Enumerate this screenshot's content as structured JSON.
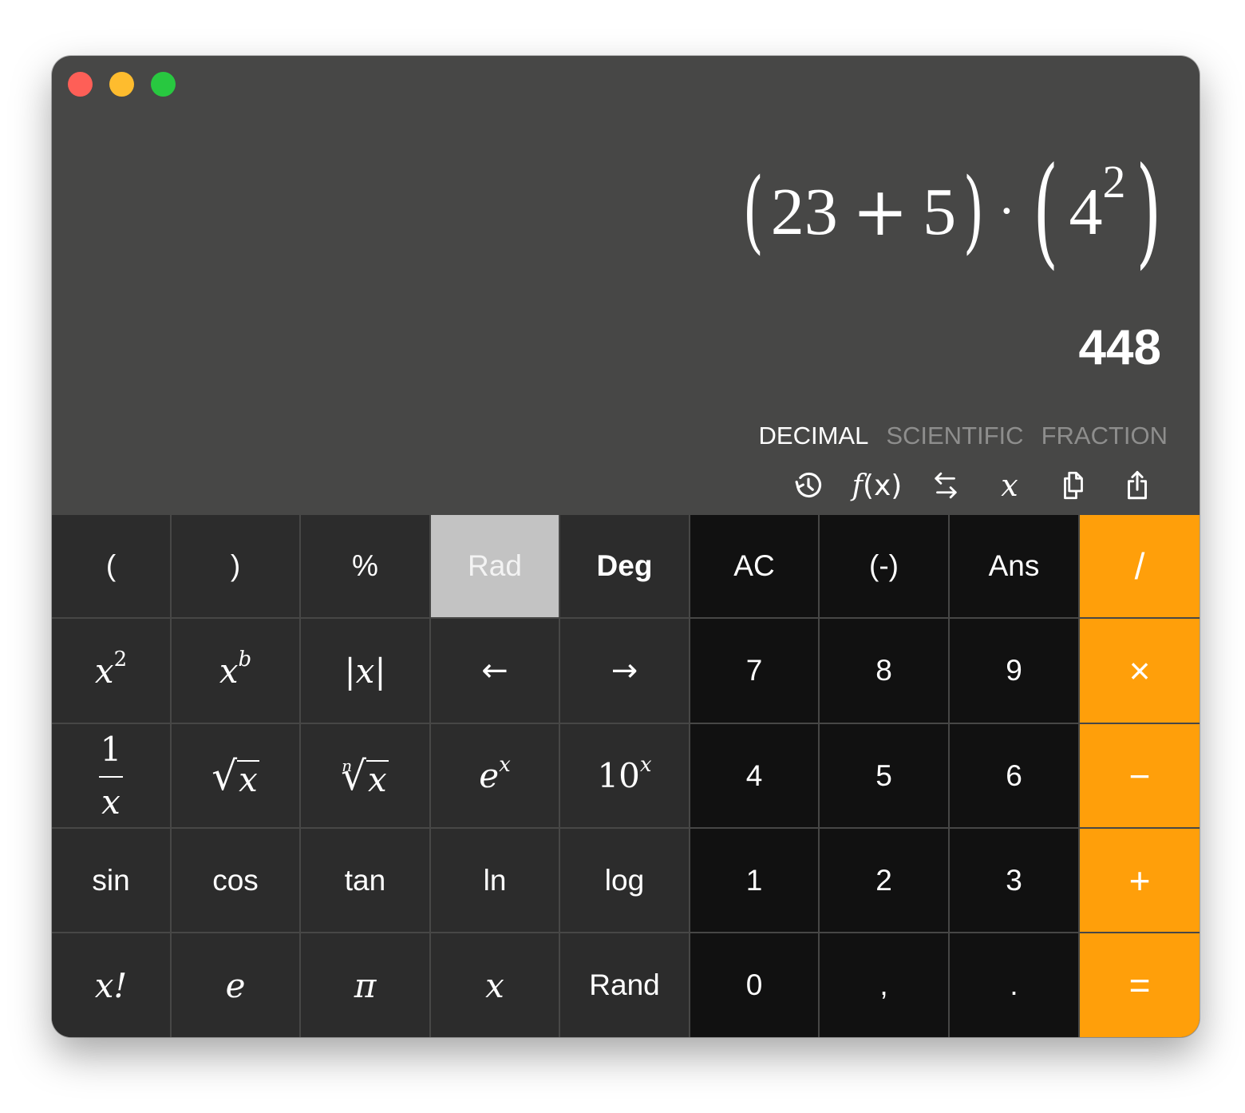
{
  "window": {
    "controls": [
      "close",
      "minimize",
      "zoom"
    ],
    "colors": {
      "close": "#fe5f57",
      "minimize": "#febc2e",
      "zoom": "#28c840",
      "background": "#474746",
      "accent": "#ff9f0a"
    }
  },
  "display": {
    "expression": {
      "open1": "(",
      "a": "23",
      "plus": "+",
      "b": "5",
      "close1": ")",
      "dot": "·",
      "open2": "(",
      "base": "4",
      "exponent": "2",
      "close2": ")"
    },
    "result": "448",
    "modes": [
      {
        "label": "DECIMAL",
        "active": true
      },
      {
        "label": "SCIENTIFIC",
        "active": false
      },
      {
        "label": "FRACTION",
        "active": false
      }
    ],
    "tools": [
      {
        "name": "history-icon"
      },
      {
        "name": "function-icon",
        "label_f": "f",
        "label_rest": "(x)"
      },
      {
        "name": "swap-icon"
      },
      {
        "name": "variable-icon",
        "label": "x"
      },
      {
        "name": "copy-icon"
      },
      {
        "name": "share-icon"
      }
    ]
  },
  "keypad": {
    "row1": {
      "lparen": "(",
      "rparen": ")",
      "percent": "%",
      "rad": "Rad",
      "deg": "Deg",
      "ac": "AC",
      "neg": "(-)",
      "ans": "Ans",
      "divide": "/"
    },
    "row2": {
      "square_base": "x",
      "square_exp": "2",
      "power_base": "x",
      "power_exp": "b",
      "abs": "|x|",
      "left": "←",
      "right": "→",
      "seven": "7",
      "eight": "8",
      "nine": "9",
      "multiply": "×"
    },
    "row3": {
      "recip_num": "1",
      "recip_den": "x",
      "sqrt_arg": "x",
      "nroot_index": "n",
      "nroot_arg": "x",
      "exp_base": "e",
      "exp_exp": "x",
      "pow10_base": "10",
      "pow10_exp": "x",
      "four": "4",
      "five": "5",
      "six": "6",
      "minus": "−"
    },
    "row4": {
      "sin": "sin",
      "cos": "cos",
      "tan": "tan",
      "ln": "ln",
      "log": "log",
      "one": "1",
      "two": "2",
      "three": "3",
      "plus": "+"
    },
    "row5": {
      "factorial": "x!",
      "e": "e",
      "pi": "π",
      "x": "x",
      "rand": "Rand",
      "zero": "0",
      "comma": ",",
      "point": ".",
      "equals": "="
    },
    "angle_mode_selected": "Rad"
  }
}
